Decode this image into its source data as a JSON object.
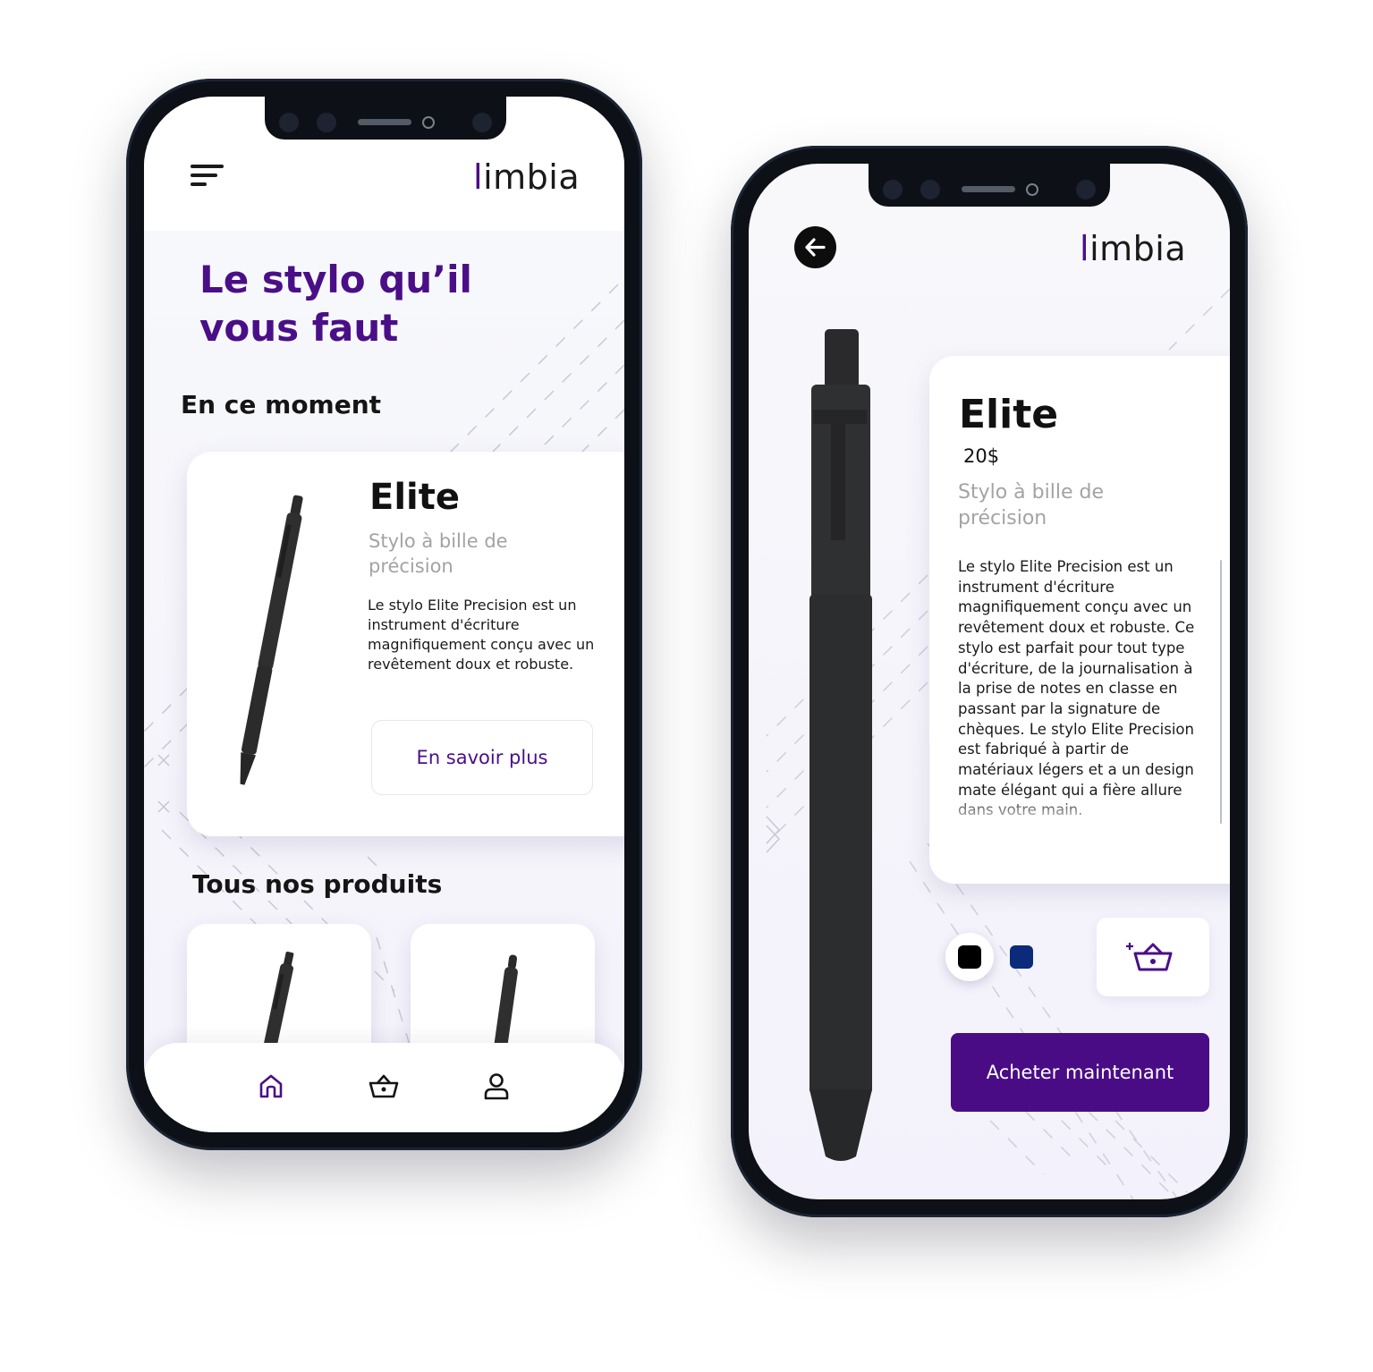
{
  "brand": {
    "logo_text": "imbia",
    "logo_letter": "l"
  },
  "colors": {
    "accent": "#4a0f87",
    "swatch_black": "#000000",
    "swatch_navy": "#0b2a7a"
  },
  "home": {
    "headline": "Le stylo qu’il vous faut",
    "featured_section": "En ce moment",
    "featured": {
      "name": "Elite",
      "subtitle": "Stylo  à bille de précision",
      "description": "Le stylo Elite Precision est un instrument d'écriture magnifiquement conçu avec un revêtement doux et robuste.",
      "cta": "En savoir plus"
    },
    "all_products_section": "Tous nos produits",
    "nav": [
      "home-icon",
      "basket-icon",
      "user-icon"
    ]
  },
  "detail": {
    "name": "Elite",
    "price": "20$",
    "subtitle": "Stylo  à bille de précision",
    "description": "Le stylo Elite Precision est un instrument d'écriture magnifiquement conçu avec un revêtement doux et robuste. Ce stylo est parfait pour tout type d'écriture, de la journalisation à la prise de notes en classe en passant par la signature de chèques. Le stylo Elite Precision est fabriqué à partir de matériaux légers et a un design mate élégant qui a fière allure dans votre main.",
    "colors": [
      "#000000",
      "#0b2a7a"
    ],
    "buy_label": "Acheter maintenant",
    "icons": [
      "arrow-left-icon",
      "add-to-basket-icon"
    ]
  }
}
